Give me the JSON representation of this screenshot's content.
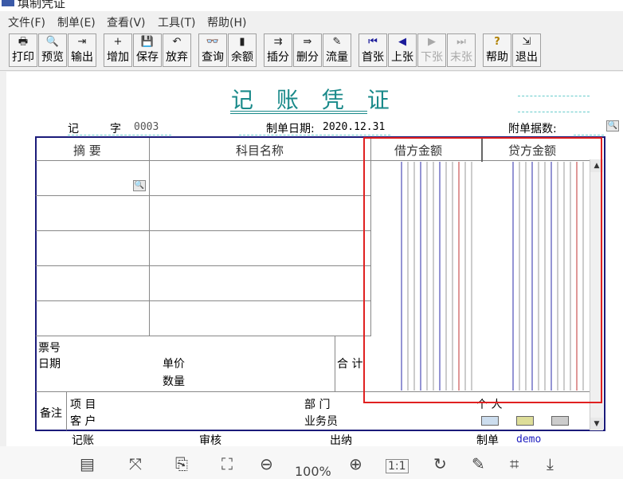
{
  "window": {
    "title": "填制凭证"
  },
  "menu": [
    "文件(F)",
    "制单(E)",
    "查看(V)",
    "工具(T)",
    "帮助(H)"
  ],
  "toolbar": [
    {
      "icon": "print-icon",
      "glyph": "🖶",
      "label": "打印",
      "enabled": true
    },
    {
      "icon": "preview-icon",
      "glyph": "🔍",
      "label": "预览",
      "enabled": true
    },
    {
      "icon": "export-icon",
      "glyph": "⇥",
      "label": "输出",
      "enabled": true
    },
    {
      "icon": "add-icon",
      "glyph": "+",
      "label": "增加",
      "enabled": true
    },
    {
      "icon": "save-icon",
      "glyph": "💾",
      "label": "保存",
      "enabled": true
    },
    {
      "icon": "undo-icon",
      "glyph": "↶",
      "label": "放弃",
      "enabled": true
    },
    {
      "icon": "binoculars-icon",
      "glyph": "👓",
      "label": "查询",
      "enabled": true
    },
    {
      "icon": "balance-chart-icon",
      "glyph": "▮",
      "label": "余额",
      "enabled": true
    },
    {
      "icon": "insert-row-icon",
      "glyph": "⇉",
      "label": "插分",
      "enabled": true
    },
    {
      "icon": "delete-row-icon",
      "glyph": "⇛",
      "label": "删分",
      "enabled": true
    },
    {
      "icon": "flow-icon",
      "glyph": "✎",
      "label": "流量",
      "enabled": true
    },
    {
      "icon": "first-icon",
      "glyph": "⏮",
      "label": "首张",
      "enabled": true
    },
    {
      "icon": "prev-icon",
      "glyph": "◀",
      "label": "上张",
      "enabled": true
    },
    {
      "icon": "next-icon",
      "glyph": "▶",
      "label": "下张",
      "enabled": false
    },
    {
      "icon": "last-icon",
      "glyph": "⏭",
      "label": "末张",
      "enabled": false
    },
    {
      "icon": "help-icon",
      "glyph": "?",
      "label": "帮助",
      "enabled": true
    },
    {
      "icon": "exit-icon",
      "glyph": "⇲",
      "label": "退出",
      "enabled": true
    }
  ],
  "voucher": {
    "title": "记 账 凭 证",
    "type_label": "记",
    "number_label": "字",
    "number": "0003",
    "date_label": "制单日期:",
    "date": "2020.12.31",
    "attachments_label": "附单据数:",
    "columns": {
      "summary": "摘 要",
      "account": "科目名称",
      "debit": "借方金额",
      "credit": "贷方金额"
    },
    "footer_fields": {
      "ticket_no": "票号",
      "date": "日期",
      "unit_price": "单价",
      "quantity": "数量",
      "total": "合 计"
    },
    "remarks": {
      "label": "备注",
      "project": "项  目",
      "customer": "客  户",
      "department": "部  门",
      "salesperson": "业务员",
      "individual": "个  人"
    },
    "signatures": {
      "bookkeeper": "记账",
      "reviewer": "审核",
      "cashier": "出纳",
      "preparer_label": "制单",
      "preparer": "demo"
    }
  },
  "bottom_toolbar": {
    "zoom": "100%",
    "icons": [
      "layout-icon",
      "fit-screen-icon",
      "ocr-icon",
      "crop-fit-icon",
      "zoom-out-icon",
      "zoom-in-icon",
      "actual-size-icon",
      "rotate-icon",
      "edit-icon",
      "crop-icon",
      "download-icon"
    ]
  },
  "colors": {
    "title": "#1a8a8a",
    "border": "#1b1b7a",
    "highlight": "#e02020",
    "preparer": "#2020c0"
  }
}
